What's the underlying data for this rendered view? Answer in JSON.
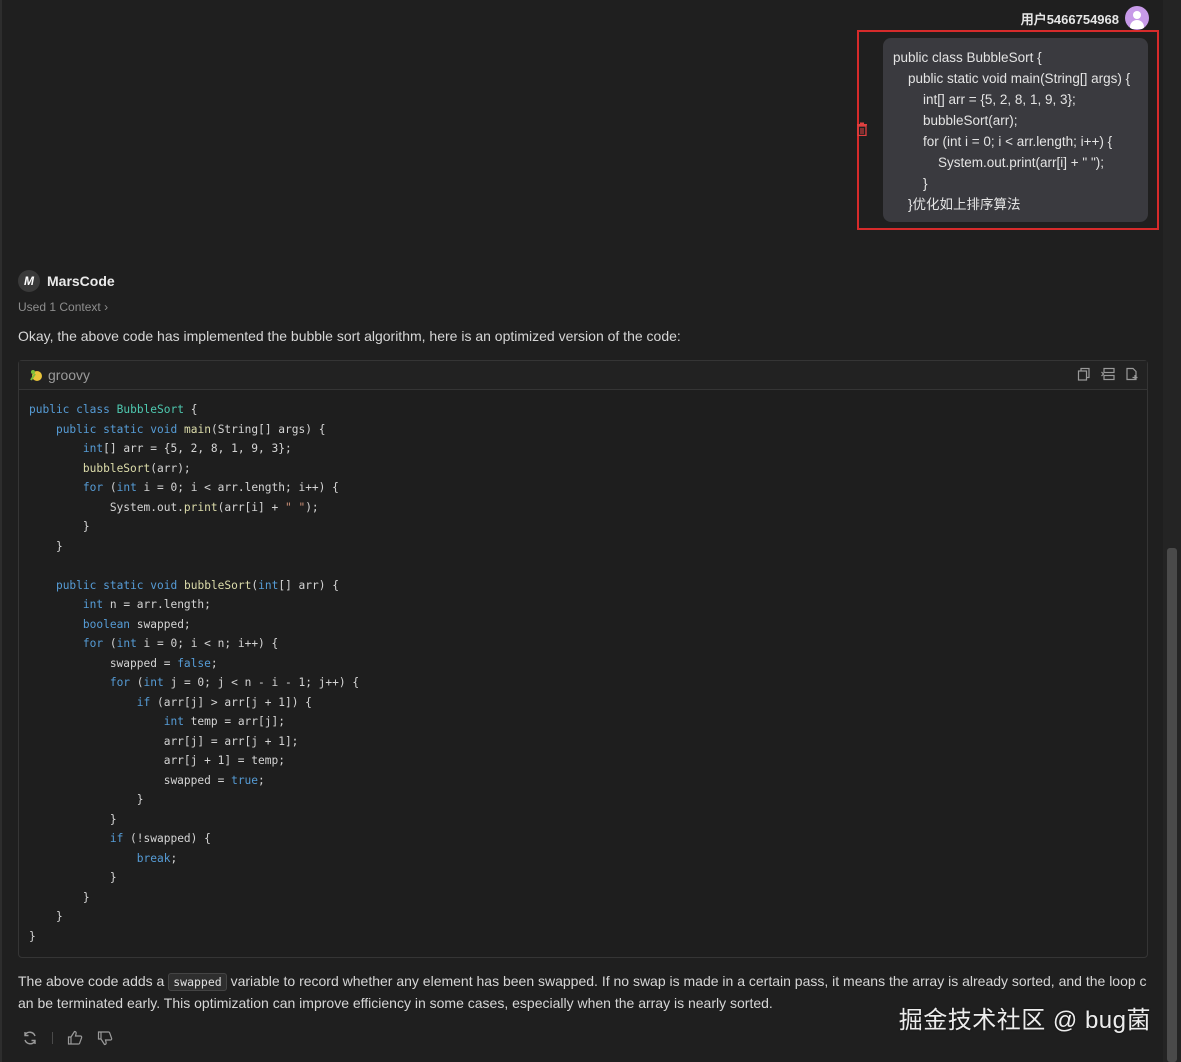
{
  "colors": {
    "background": "#1f1f1f",
    "user_bubble": "#3a3a3f",
    "highlight_border": "#d62b2b",
    "avatar": "#c79ae8",
    "keyword": "#569cd6"
  },
  "user": {
    "name": "用户5466754968",
    "message": "public class BubbleSort {\n    public static void main(String[] args) {\n        int[] arr = {5, 2, 8, 1, 9, 3};\n        bubbleSort(arr);\n        for (int i = 0; i < arr.length; i++) {\n            System.out.print(arr[i] + \" \");\n        }\n    }优化如上排序算法"
  },
  "assistant": {
    "name": "MarsCode",
    "context_label": "Used 1 Context",
    "intro": "Okay, the above code has implemented the bubble sort algorithm, here is an optimized version of the code:",
    "code_language": "groovy",
    "outro_before": "The above code adds a ",
    "outro_code": "swapped",
    "outro_after": " variable to record whether any element has been swapped. If no swap is made in a certain pass, it means the array is already sorted, and the loop can be terminated early. This optimization can improve efficiency in some cases, especially when the array is nearly sorted."
  },
  "code_lines": [
    "public class BubbleSort {",
    "    public static void main(String[] args) {",
    "        int[] arr = {5, 2, 8, 1, 9, 3};",
    "        bubbleSort(arr);",
    "        for (int i = 0; i < arr.length; i++) {",
    "            System.out.print(arr[i] + \" \");",
    "        }",
    "    }",
    "",
    "    public static void bubbleSort(int[] arr) {",
    "        int n = arr.length;",
    "        boolean swapped;",
    "        for (int i = 0; i < n; i++) {",
    "            swapped = false;",
    "            for (int j = 0; j < n - i - 1; j++) {",
    "                if (arr[j] > arr[j + 1]) {",
    "                    int temp = arr[j];",
    "                    arr[j] = arr[j + 1];",
    "                    arr[j + 1] = temp;",
    "                    swapped = true;",
    "                }",
    "            }",
    "            if (!swapped) {",
    "                break;",
    "            }",
    "        }",
    "    }",
    "}"
  ],
  "icons": {
    "delete": "trash-icon",
    "copy": "copy-icon",
    "insert": "insert-icon",
    "new_file": "new-file-icon",
    "regenerate": "refresh-icon",
    "like": "thumbs-up-icon",
    "dislike": "thumbs-down-icon"
  },
  "watermark": "掘金技术社区 @ bug菌"
}
